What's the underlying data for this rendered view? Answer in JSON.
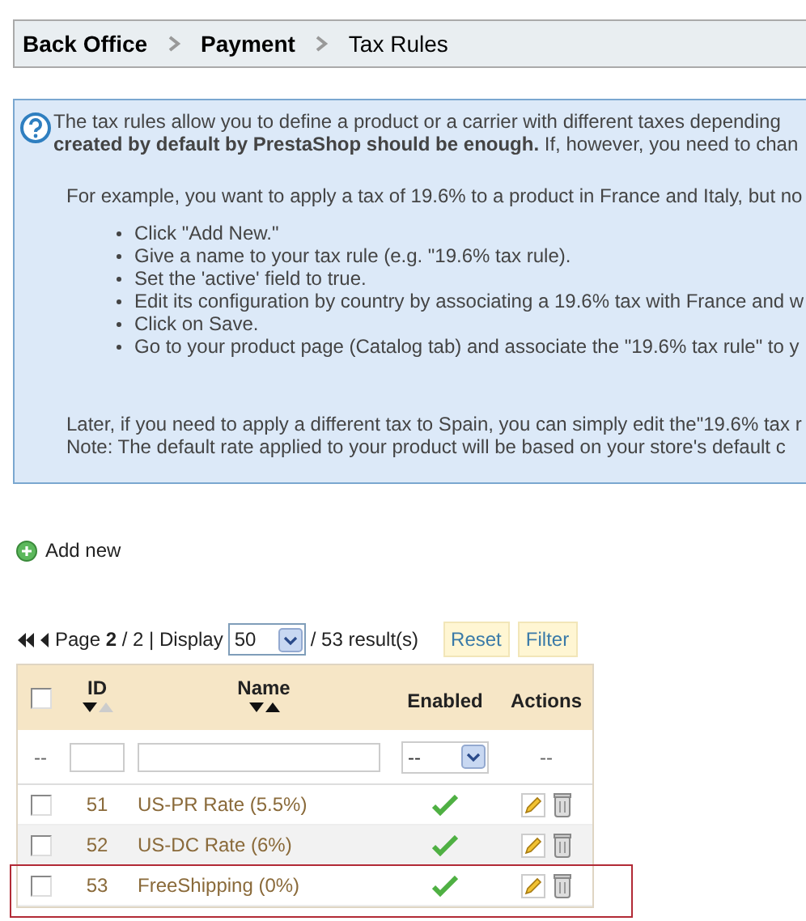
{
  "breadcrumb": [
    {
      "label": "Back Office",
      "current": false
    },
    {
      "label": "Payment",
      "current": false
    },
    {
      "label": "Tax Rules",
      "current": true
    }
  ],
  "info": {
    "intro": "The tax rules allow you to define a product or a carrier with different taxes depending",
    "intro2": "**created by default by PrestaShop should be enough.** If, however, you need to chan",
    "example": "For example, you want to apply a tax of 19.6% to a product in France and Italy, but no",
    "steps": [
      "Click \"Add New.\"",
      "Give a name to your tax rule (e.g. \"19.6% tax rule).",
      "Set the 'active' field to true.",
      "Edit its configuration by country by associating a 19.6% tax with France and w",
      "Click on Save.",
      "Go to your product page (Catalog tab) and associate the \"19.6% tax rule\" to y"
    ],
    "later": "Later, if you need to apply a different tax to Spain, you can simply edit the\"19.6% tax r",
    "note": "Note: The default rate applied to your product will be based on your store's default c"
  },
  "add_new": "Add new",
  "pagination": {
    "page_label": "Page ",
    "page": "2",
    "of": " / 2 | Display",
    "display": "50",
    "results": "/ 53 result(s)",
    "reset": "Reset",
    "filter": "Filter"
  },
  "table": {
    "columns": [
      {
        "label": "ID",
        "desc_active": true,
        "asc_active": false
      },
      {
        "label": "Name",
        "desc_active": true,
        "asc_active": true
      },
      {
        "label": "Enabled"
      },
      {
        "label": "Actions"
      }
    ],
    "select_all_checked": false,
    "filters": {
      "select_all": "--",
      "enabled": "--",
      "actions": "--"
    },
    "rows": [
      {
        "id": "51",
        "name": "US-PR Rate (5.5%)",
        "checked": false,
        "enabled": true,
        "highlighted": false
      },
      {
        "id": "52",
        "name": "US-DC Rate (6%)",
        "checked": false,
        "enabled": true,
        "highlighted": false
      },
      {
        "id": "53",
        "name": "FreeShipping (0%)",
        "checked": false,
        "enabled": true,
        "highlighted": true
      }
    ]
  }
}
